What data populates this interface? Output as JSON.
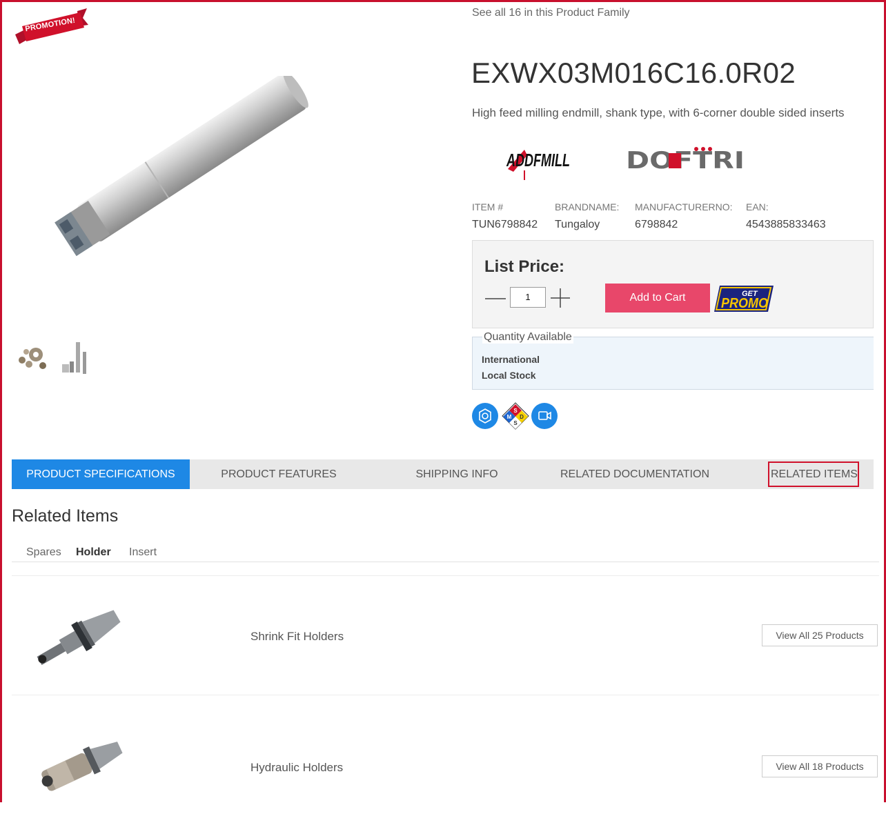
{
  "promo_ribbon": "PROMOTION!",
  "family_link": "See all 16 in this Product Family",
  "product": {
    "title": "EXWX03M016C16.0R02",
    "description": "High feed milling endmill, shank type, with 6-corner double sided inserts"
  },
  "logos": {
    "addfmill": "ADDFMILL",
    "doftri": "DOFTRI"
  },
  "meta": [
    {
      "label": "ITEM #",
      "value": "TUN6798842"
    },
    {
      "label": "BRANDNAME:",
      "value": "Tungaloy"
    },
    {
      "label": "MANUFACTURERNO:",
      "value": "6798842"
    },
    {
      "label": "EAN:",
      "value": "4543885833463"
    }
  ],
  "price": {
    "label": "List Price:",
    "quantity": "1",
    "add_to_cart": "Add to Cart",
    "promo_badge": {
      "top": "GET",
      "bottom": "PROMO"
    }
  },
  "availability": {
    "legend": "Quantity Available",
    "lines": [
      "International",
      "Local Stock"
    ]
  },
  "msds_letters": {
    "top": "S",
    "left": "M",
    "right": "D",
    "bottom": "S"
  },
  "tabs": [
    "PRODUCT SPECIFICATIONS",
    "PRODUCT FEATURES",
    "SHIPPING INFO",
    "RELATED DOCUMENTATION",
    "RELATED ITEMS"
  ],
  "related": {
    "title": "Related Items",
    "subtabs": [
      "Spares",
      "Holder",
      "Insert"
    ],
    "items": [
      {
        "label": "Shrink Fit Holders",
        "button": "View All 25 Products"
      },
      {
        "label": "Hydraulic Holders",
        "button": "View All 18 Products"
      }
    ]
  },
  "colors": {
    "accent": "#1e88e5",
    "cart": "#e8476a",
    "frame": "#c8102e"
  }
}
